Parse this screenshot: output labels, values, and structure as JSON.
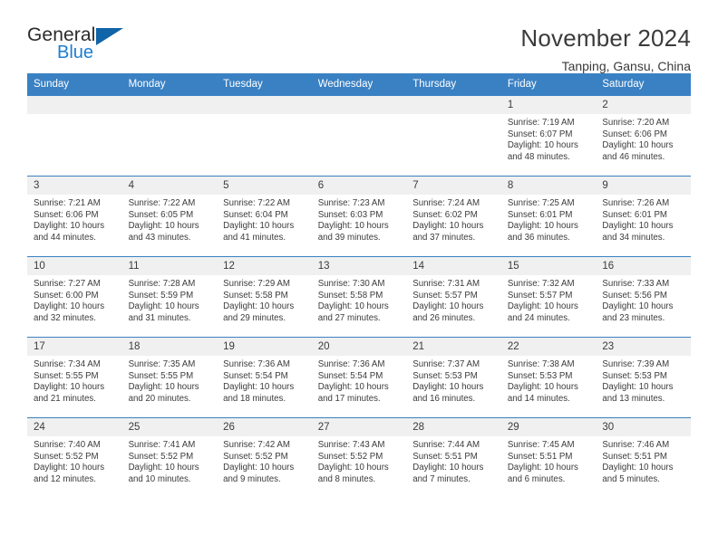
{
  "logo": {
    "word_one": "General",
    "word_two": "Blue",
    "icon": "triangle-mark"
  },
  "header": {
    "title": "November 2024",
    "location": "Tanping, Gansu, China"
  },
  "calendar": {
    "weekday_headers": [
      "Sunday",
      "Monday",
      "Tuesday",
      "Wednesday",
      "Thursday",
      "Friday",
      "Saturday"
    ],
    "labels": {
      "sunrise": "Sunrise:",
      "sunset": "Sunset:",
      "daylight": "Daylight:"
    },
    "colors": {
      "header_blue": "#3a81c3",
      "daynum_band": "#f0f0f0",
      "text": "#3b3b3b",
      "logo_blue": "#1c7fd1"
    },
    "weeks": [
      [
        {
          "day": "",
          "sunrise": "",
          "sunset": "",
          "daylight": ""
        },
        {
          "day": "",
          "sunrise": "",
          "sunset": "",
          "daylight": ""
        },
        {
          "day": "",
          "sunrise": "",
          "sunset": "",
          "daylight": ""
        },
        {
          "day": "",
          "sunrise": "",
          "sunset": "",
          "daylight": ""
        },
        {
          "day": "",
          "sunrise": "",
          "sunset": "",
          "daylight": ""
        },
        {
          "day": "1",
          "sunrise": "Sunrise: 7:19 AM",
          "sunset": "Sunset: 6:07 PM",
          "daylight": "Daylight: 10 hours and 48 minutes."
        },
        {
          "day": "2",
          "sunrise": "Sunrise: 7:20 AM",
          "sunset": "Sunset: 6:06 PM",
          "daylight": "Daylight: 10 hours and 46 minutes."
        }
      ],
      [
        {
          "day": "3",
          "sunrise": "Sunrise: 7:21 AM",
          "sunset": "Sunset: 6:06 PM",
          "daylight": "Daylight: 10 hours and 44 minutes."
        },
        {
          "day": "4",
          "sunrise": "Sunrise: 7:22 AM",
          "sunset": "Sunset: 6:05 PM",
          "daylight": "Daylight: 10 hours and 43 minutes."
        },
        {
          "day": "5",
          "sunrise": "Sunrise: 7:22 AM",
          "sunset": "Sunset: 6:04 PM",
          "daylight": "Daylight: 10 hours and 41 minutes."
        },
        {
          "day": "6",
          "sunrise": "Sunrise: 7:23 AM",
          "sunset": "Sunset: 6:03 PM",
          "daylight": "Daylight: 10 hours and 39 minutes."
        },
        {
          "day": "7",
          "sunrise": "Sunrise: 7:24 AM",
          "sunset": "Sunset: 6:02 PM",
          "daylight": "Daylight: 10 hours and 37 minutes."
        },
        {
          "day": "8",
          "sunrise": "Sunrise: 7:25 AM",
          "sunset": "Sunset: 6:01 PM",
          "daylight": "Daylight: 10 hours and 36 minutes."
        },
        {
          "day": "9",
          "sunrise": "Sunrise: 7:26 AM",
          "sunset": "Sunset: 6:01 PM",
          "daylight": "Daylight: 10 hours and 34 minutes."
        }
      ],
      [
        {
          "day": "10",
          "sunrise": "Sunrise: 7:27 AM",
          "sunset": "Sunset: 6:00 PM",
          "daylight": "Daylight: 10 hours and 32 minutes."
        },
        {
          "day": "11",
          "sunrise": "Sunrise: 7:28 AM",
          "sunset": "Sunset: 5:59 PM",
          "daylight": "Daylight: 10 hours and 31 minutes."
        },
        {
          "day": "12",
          "sunrise": "Sunrise: 7:29 AM",
          "sunset": "Sunset: 5:58 PM",
          "daylight": "Daylight: 10 hours and 29 minutes."
        },
        {
          "day": "13",
          "sunrise": "Sunrise: 7:30 AM",
          "sunset": "Sunset: 5:58 PM",
          "daylight": "Daylight: 10 hours and 27 minutes."
        },
        {
          "day": "14",
          "sunrise": "Sunrise: 7:31 AM",
          "sunset": "Sunset: 5:57 PM",
          "daylight": "Daylight: 10 hours and 26 minutes."
        },
        {
          "day": "15",
          "sunrise": "Sunrise: 7:32 AM",
          "sunset": "Sunset: 5:57 PM",
          "daylight": "Daylight: 10 hours and 24 minutes."
        },
        {
          "day": "16",
          "sunrise": "Sunrise: 7:33 AM",
          "sunset": "Sunset: 5:56 PM",
          "daylight": "Daylight: 10 hours and 23 minutes."
        }
      ],
      [
        {
          "day": "17",
          "sunrise": "Sunrise: 7:34 AM",
          "sunset": "Sunset: 5:55 PM",
          "daylight": "Daylight: 10 hours and 21 minutes."
        },
        {
          "day": "18",
          "sunrise": "Sunrise: 7:35 AM",
          "sunset": "Sunset: 5:55 PM",
          "daylight": "Daylight: 10 hours and 20 minutes."
        },
        {
          "day": "19",
          "sunrise": "Sunrise: 7:36 AM",
          "sunset": "Sunset: 5:54 PM",
          "daylight": "Daylight: 10 hours and 18 minutes."
        },
        {
          "day": "20",
          "sunrise": "Sunrise: 7:36 AM",
          "sunset": "Sunset: 5:54 PM",
          "daylight": "Daylight: 10 hours and 17 minutes."
        },
        {
          "day": "21",
          "sunrise": "Sunrise: 7:37 AM",
          "sunset": "Sunset: 5:53 PM",
          "daylight": "Daylight: 10 hours and 16 minutes."
        },
        {
          "day": "22",
          "sunrise": "Sunrise: 7:38 AM",
          "sunset": "Sunset: 5:53 PM",
          "daylight": "Daylight: 10 hours and 14 minutes."
        },
        {
          "day": "23",
          "sunrise": "Sunrise: 7:39 AM",
          "sunset": "Sunset: 5:53 PM",
          "daylight": "Daylight: 10 hours and 13 minutes."
        }
      ],
      [
        {
          "day": "24",
          "sunrise": "Sunrise: 7:40 AM",
          "sunset": "Sunset: 5:52 PM",
          "daylight": "Daylight: 10 hours and 12 minutes."
        },
        {
          "day": "25",
          "sunrise": "Sunrise: 7:41 AM",
          "sunset": "Sunset: 5:52 PM",
          "daylight": "Daylight: 10 hours and 10 minutes."
        },
        {
          "day": "26",
          "sunrise": "Sunrise: 7:42 AM",
          "sunset": "Sunset: 5:52 PM",
          "daylight": "Daylight: 10 hours and 9 minutes."
        },
        {
          "day": "27",
          "sunrise": "Sunrise: 7:43 AM",
          "sunset": "Sunset: 5:52 PM",
          "daylight": "Daylight: 10 hours and 8 minutes."
        },
        {
          "day": "28",
          "sunrise": "Sunrise: 7:44 AM",
          "sunset": "Sunset: 5:51 PM",
          "daylight": "Daylight: 10 hours and 7 minutes."
        },
        {
          "day": "29",
          "sunrise": "Sunrise: 7:45 AM",
          "sunset": "Sunset: 5:51 PM",
          "daylight": "Daylight: 10 hours and 6 minutes."
        },
        {
          "day": "30",
          "sunrise": "Sunrise: 7:46 AM",
          "sunset": "Sunset: 5:51 PM",
          "daylight": "Daylight: 10 hours and 5 minutes."
        }
      ]
    ]
  }
}
